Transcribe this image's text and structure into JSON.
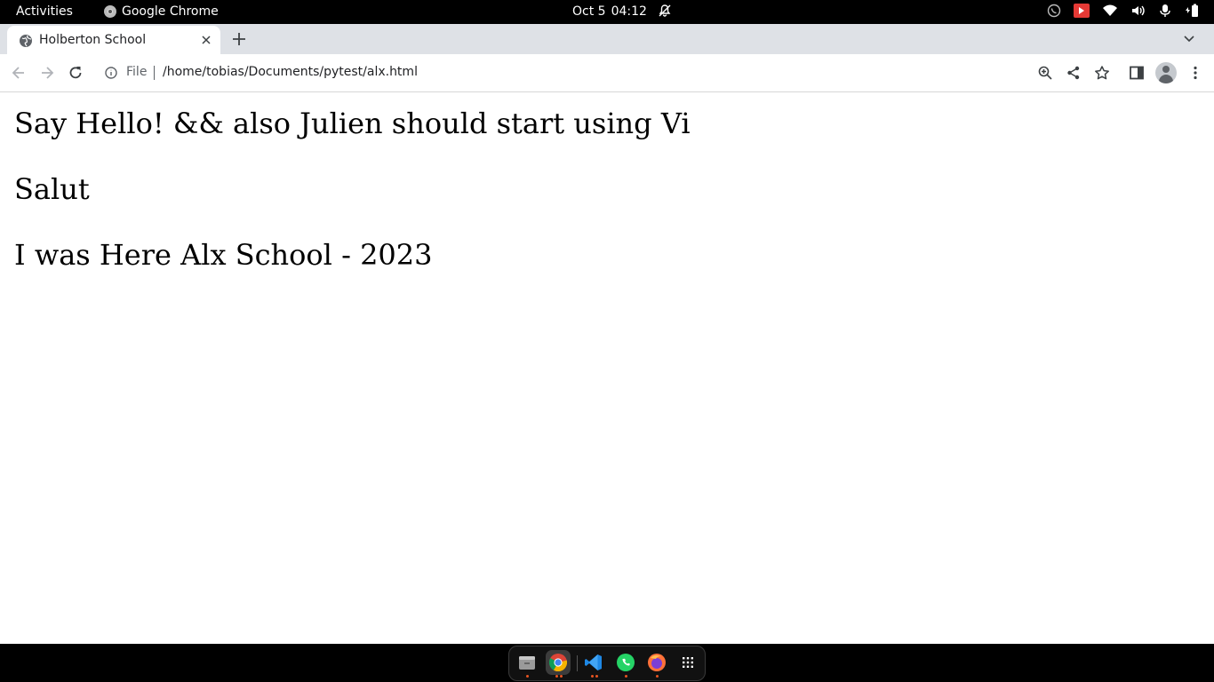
{
  "topbar": {
    "activities": "Activities",
    "app_name": "Google Chrome",
    "date": "Oct 5",
    "time": "04:12"
  },
  "browser": {
    "tab_title": "Holberton School",
    "omnibox_scheme": "File",
    "omnibox_url": "/home/tobias/Documents/pytest/alx.html"
  },
  "page": {
    "line1": "Say Hello! && also Julien should start using Vi",
    "line2": "Salut",
    "line3": "I was Here Alx School - 2023"
  },
  "dock": {
    "apps": [
      "files-icon",
      "chrome-icon",
      "vscode-icon",
      "whatsapp-icon",
      "firefox-icon",
      "app-grid-icon"
    ]
  },
  "colors": {
    "tab_strip": "#dee1e6",
    "ubuntu_accent": "#e95420",
    "chrome_red": "#db4437",
    "chrome_green": "#0f9d58",
    "chrome_yellow": "#f4b400",
    "chrome_blue": "#4285f4"
  }
}
